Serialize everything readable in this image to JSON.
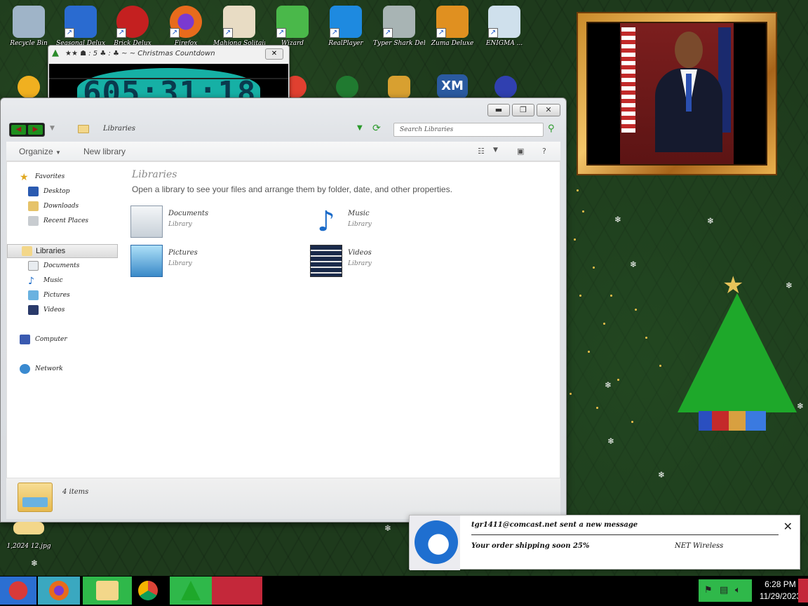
{
  "desktop_icons": [
    {
      "name": "recycle-bin",
      "label": "Recycle Bin",
      "color": "#8aa0b8"
    },
    {
      "name": "app-2",
      "label": "Seasonal Delux",
      "color": "#2a6bd0"
    },
    {
      "name": "app-red-fuzz",
      "label": "Brick Delux",
      "color": "#c42020"
    },
    {
      "name": "firefox",
      "label": "Firefox",
      "color": "#e76b1c"
    },
    {
      "name": "app-torii",
      "label": "Mahjong Solitaire",
      "color": "#d8c8a8"
    },
    {
      "name": "app-frog",
      "label": "Wizard",
      "color": "#3aa83a"
    },
    {
      "name": "realplayer",
      "label": "RealPlayer",
      "color": "#1e8ae0"
    },
    {
      "name": "typer-shark",
      "label": "Typer Shark Deluxe",
      "color": "#9aa8a8"
    },
    {
      "name": "zuma",
      "label": "Zuma Deluxe",
      "color": "#e09020"
    },
    {
      "name": "enigma",
      "label": "ENIGMA ...",
      "color": "#88b8d8"
    }
  ],
  "second_row_icons": [
    {
      "name": "app-yellow",
      "color": "#f0b020"
    },
    {
      "name": "app-ball",
      "color": "#e04030"
    },
    {
      "name": "app-green-sphere",
      "color": "#207a30"
    },
    {
      "name": "app-gold",
      "color": "#d8a030"
    },
    {
      "name": "app-xm",
      "label": "XM",
      "color": "#2a5aa0"
    },
    {
      "name": "app-globe",
      "color": "#3040b0"
    }
  ],
  "timer_window": {
    "title": "★★ ☗ : 5 ♣ : ♣ ~ ~ Christmas Countdown",
    "close": "✕",
    "countdown": "605:31:18"
  },
  "explorer": {
    "address": "Libraries",
    "search_placeholder": "Search Libraries",
    "toolbar": {
      "organize": "Organize",
      "new_library": "New library",
      "help": "?"
    },
    "window_controls": {
      "minimize": "▬",
      "maximize": "❐",
      "close": "✕"
    },
    "nav": {
      "favorites": "Favorites",
      "desktop": "Desktop",
      "downloads": "Downloads",
      "recent_places": "Recent Places",
      "libraries": "Libraries",
      "documents": "Documents",
      "music": "Music",
      "pictures": "Pictures",
      "videos": "Videos",
      "computer": "Computer",
      "network": "Network"
    },
    "main": {
      "title": "Libraries",
      "description": "Open a library to see your files and arrange them by folder, date, and other properties.",
      "libraries": [
        {
          "name": "Documents",
          "type": "Library"
        },
        {
          "name": "Music",
          "type": "Library"
        },
        {
          "name": "Pictures",
          "type": "Library"
        },
        {
          "name": "Videos",
          "type": "Library"
        }
      ]
    },
    "details": {
      "count": "4 items"
    }
  },
  "desktop_bottom_icon": {
    "label": "1,2024 12.jpg"
  },
  "notification": {
    "sender": "tgr1411@comcast.net sent a new message",
    "subject": "Your order shipping soon 25%",
    "from": "NET Wireless",
    "close": "✕"
  },
  "taskbar": {
    "clock_time": "6:28 PM",
    "clock_date": "11/29/2023"
  }
}
